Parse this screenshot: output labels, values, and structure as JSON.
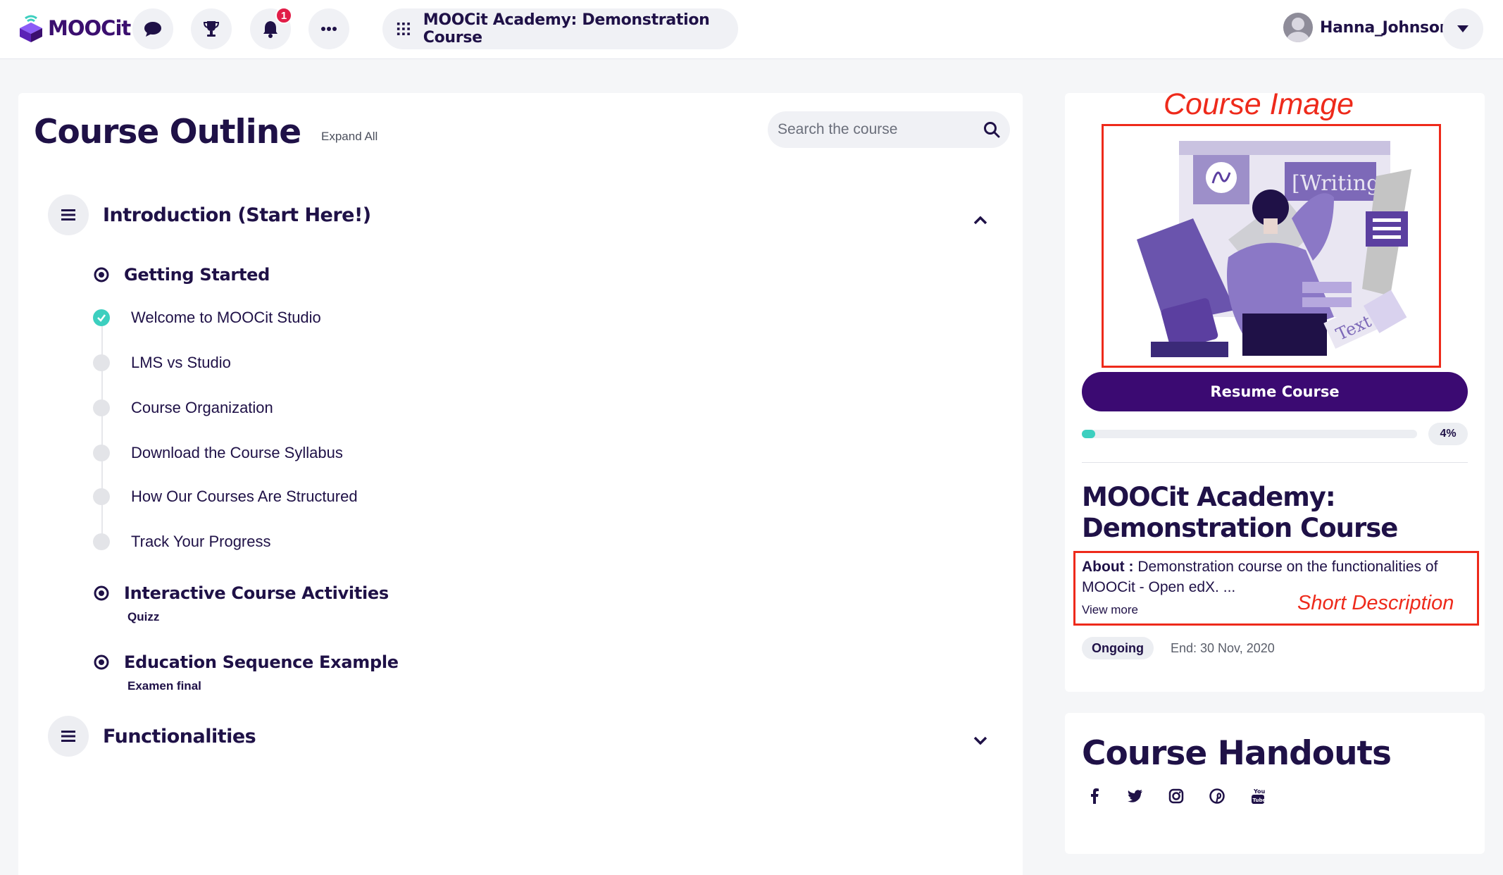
{
  "header": {
    "logo_text": "MOOCit",
    "notifications_count": "1",
    "course_title": "MOOCit Academy: Demonstration Course",
    "user_name": "Hanna_Johnson"
  },
  "outline": {
    "title": "Course Outline",
    "expand_all": "Expand All",
    "search_placeholder": "Search the course",
    "sections": [
      {
        "title": "Introduction (Start Here!)",
        "expanded": true,
        "subsections": [
          {
            "title": "Getting Started",
            "units": [
              {
                "label": "Welcome to MOOCit Studio",
                "completed": true
              },
              {
                "label": "LMS vs Studio",
                "completed": false
              },
              {
                "label": "Course Organization",
                "completed": false
              },
              {
                "label": "Download the Course Syllabus",
                "completed": false
              },
              {
                "label": "How Our Courses Are Structured",
                "completed": false
              },
              {
                "label": "Track Your Progress",
                "completed": false
              }
            ]
          },
          {
            "title": "Interactive Course Activities",
            "meta": "Quizz"
          },
          {
            "title": "Education Sequence Example",
            "meta": "Examen final"
          }
        ]
      },
      {
        "title": "Functionalities",
        "expanded": false
      }
    ]
  },
  "sidebar": {
    "annotation_image": "Course Image",
    "resume_label": "Resume Course",
    "progress_percent": 4,
    "progress_label": "4%",
    "course_name": "MOOCit Academy: Demonstration Course",
    "about_label": "About :",
    "about_text": "Demonstration course on the functionalities of MOOCit - Open edX. ...",
    "view_more": "View more",
    "annotation_description": "Short Description",
    "status": "Ongoing",
    "end_date": "End: 30 Nov, 2020"
  },
  "handouts": {
    "title": "Course Handouts",
    "social_icons": [
      "facebook-icon",
      "twitter-icon",
      "instagram-icon",
      "pinterest-icon",
      "youtube-icon"
    ]
  },
  "colors": {
    "brand": "#3b0a72",
    "accent": "#3ccfbf",
    "annotation": "#ee2a1b",
    "badge": "#e11d48"
  }
}
